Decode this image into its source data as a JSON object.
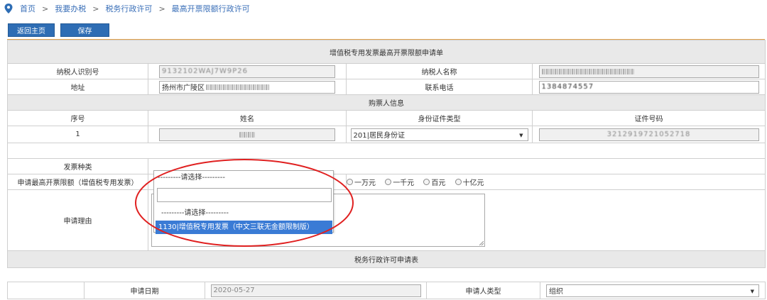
{
  "breadcrumb": [
    "首页",
    "我要办税",
    "税务行政许可",
    "最高开票限额行政许可"
  ],
  "breadcrumb_sep": ">",
  "toolbar": {
    "back_label": "返回主页",
    "save_label": "保存"
  },
  "form": {
    "title": "增值税专用发票最高开票限额申请单",
    "taxpayer_id_label": "纳税人识别号",
    "taxpayer_id_value": "9132102WAJ7W9P26",
    "taxpayer_name_label": "纳税人名称",
    "address_label": "地址",
    "address_value": "扬州市广陵区",
    "phone_label": "联系电话",
    "phone_value": "1384874557",
    "buyer_section": "购票人信息",
    "col_seq": "序号",
    "col_name": "姓名",
    "col_id_type": "身份证件类型",
    "col_id_no": "证件号码",
    "row1_seq": "1",
    "row1_id_type": "201|居民身份证",
    "row1_id_no": "3212919721052718",
    "invoice_type_label": "发票种类",
    "limit_label": "申请最高开票限额（增值税专用发票）",
    "limit_options": [
      "一万元",
      "一千元",
      "百元",
      "十亿元"
    ],
    "reason_label": "申请理由",
    "permit_section": "税务行政许可申请表",
    "apply_date_label": "申请日期",
    "apply_date_value": "2020-05-27",
    "applicant_type_label": "申请人类型",
    "applicant_type_value": "组织"
  },
  "dropdown": {
    "selected": "---------请选择---------",
    "search_value": "",
    "options": [
      "---------请选择---------",
      "1130|增值税专用发票（中文三联无金额限制版）"
    ]
  },
  "colors": {
    "link": "#3a6fb8",
    "button": "#2e6db4",
    "header_text": "#2f6db5",
    "highlight": "#3a7bd5",
    "annotation": "#e02020"
  }
}
